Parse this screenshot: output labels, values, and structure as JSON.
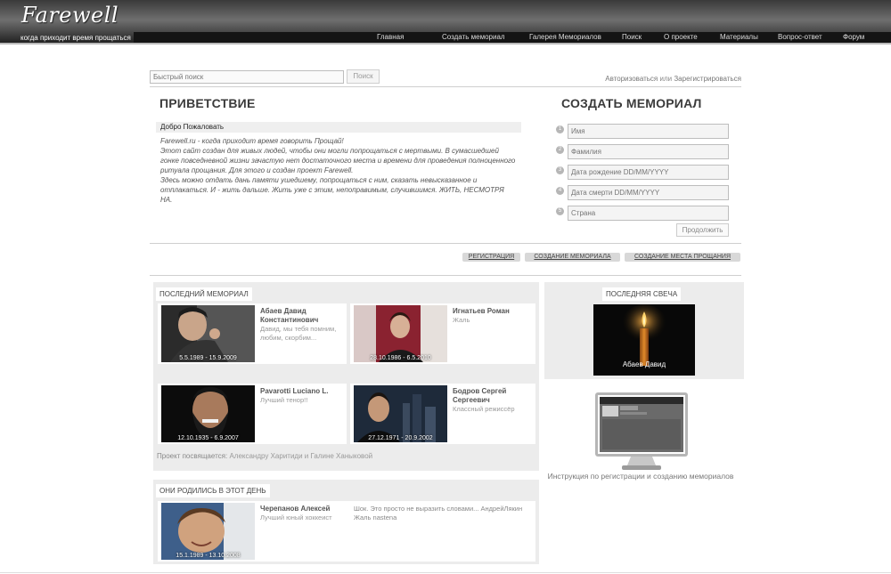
{
  "header": {
    "logo": "Farewell",
    "tagline": "когда приходит время прощаться",
    "nav": [
      "Главная",
      "Создать мемориал",
      "Галерея Мемориалов",
      "Поиск",
      "О проекте",
      "Материалы",
      "Вопрос-ответ",
      "Форум"
    ]
  },
  "search": {
    "placeholder": "Быстрый поиск",
    "button": "Поиск"
  },
  "auth": {
    "login": "Авторизоваться",
    "or": "или",
    "register": "Зарегистрироваться"
  },
  "welcome": {
    "title": "ПРИВЕТСТВИЕ",
    "subtitle": "Добро Пожаловать",
    "paragraph1": "Farewell.ru - когда приходит время говорить Прощай!",
    "paragraph2": "Этот сайт создан для живых людей, чтобы они могли попрощаться с мертвыми. В сумасшедшей гонке повседневной жизни зачастую нет достаточного места и времени для проведения полноценного ритуала прощания. Для этого и создан проект Farewell.",
    "paragraph3": "Здесь можно отдать дань памяти ушедшему, попрощаться с ним, сказать невысказанное и отплакаться. И - жить дальше. Жить уже с этим, непоправимым, случившимся. ЖИТЬ, НЕСМОТРЯ НА."
  },
  "create": {
    "title": "СОЗДАТЬ МЕМОРИАЛ",
    "fields": [
      {
        "num": "1",
        "placeholder": "Имя"
      },
      {
        "num": "2",
        "placeholder": "Фамилия"
      },
      {
        "num": "3",
        "placeholder": "Дата рождение DD/MM/YYYY"
      },
      {
        "num": "4",
        "placeholder": "Дата смерти DD/MM/YYYY"
      },
      {
        "num": "5",
        "placeholder": "Страна"
      }
    ],
    "submit": "Продолжить"
  },
  "tabs": [
    "РЕГИСТРАЦИЯ",
    "СОЗДАНИЕ МЕМОРИАЛА",
    "СОЗДАНИЕ МЕСТА ПРОЩАНИЯ"
  ],
  "last_memorial": {
    "label": "ПОСЛЕДНИЙ МЕМОРИАЛ",
    "items": [
      {
        "name": "Абаев Давид Константинович",
        "desc": "Давид, мы тебя помним, любим, скорбим...",
        "dates": "5.5.1989 - 15.9.2009"
      },
      {
        "name": "Игнатьев Роман",
        "desc": "Жаль",
        "dates": "28.10.1986 - 6.5.2010"
      },
      {
        "name": "Pavarotti Luciano L.",
        "desc": "Лучший тенор!!",
        "dates": "12.10.1935 - 6.9.2007"
      },
      {
        "name": "Бодров Сергей Сергеевич",
        "desc": "Классный режиссёр",
        "dates": "27.12.1971 - 20.9.2002"
      }
    ],
    "dedication_prefix": "Проект посвящается:",
    "dedication_names": "Александру Харитиди и Галине Ханыковой"
  },
  "born_today": {
    "label": "ОНИ РОДИЛИСЬ В ЭТОТ ДЕНЬ",
    "name": "Черепанов Алексей",
    "desc": "Лучший юный хоккеист",
    "dates": "15.1.1989 - 13.10.2008",
    "comment1": "Шок. Это просто не выразить словами... АндрейЛякин",
    "comment2": "Жаль nastena"
  },
  "last_candle": {
    "label": "ПОСЛЕДНЯЯ СВЕЧА",
    "name": "Абаев Давид"
  },
  "instructions": {
    "text": "Инструкция по регистрации и созданию мемориалов"
  }
}
